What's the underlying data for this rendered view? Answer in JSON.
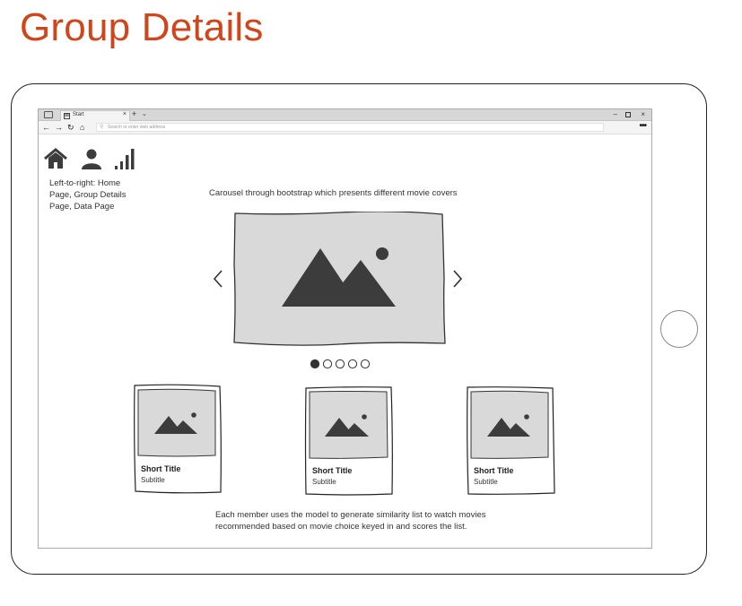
{
  "page": {
    "title": "Group Details"
  },
  "browser": {
    "tab_label": "Start",
    "tab_close": "×",
    "new_tab": "+",
    "tab_menu": "⌄",
    "address_placeholder": "Search or enter web address",
    "more": "•••",
    "win_minimize": "–",
    "win_close": "×"
  },
  "nav": {
    "icons": [
      "home-icon",
      "user-icon",
      "signal-bars-icon"
    ],
    "description": "Left-to-right: Home Page, Group Details Page, Data Page"
  },
  "carousel": {
    "caption": "Carousel through bootstrap which presents different movie covers",
    "prev": "‹",
    "next": "›",
    "dot_count": 5,
    "active_dot": 0
  },
  "cards": [
    {
      "title": "Short Title",
      "subtitle": "Subtitle"
    },
    {
      "title": "Short Title",
      "subtitle": "Subtitle"
    },
    {
      "title": "Short Title",
      "subtitle": "Subtitle"
    }
  ],
  "footer_note": "Each member uses the model to generate similarity list to watch movies recommended based on movie choice keyed in and scores the list.",
  "colors": {
    "title": "#d1451b",
    "placeholder_fill": "#d9d9d9",
    "icon_dark": "#3c3c3c",
    "frame": "#222222"
  }
}
